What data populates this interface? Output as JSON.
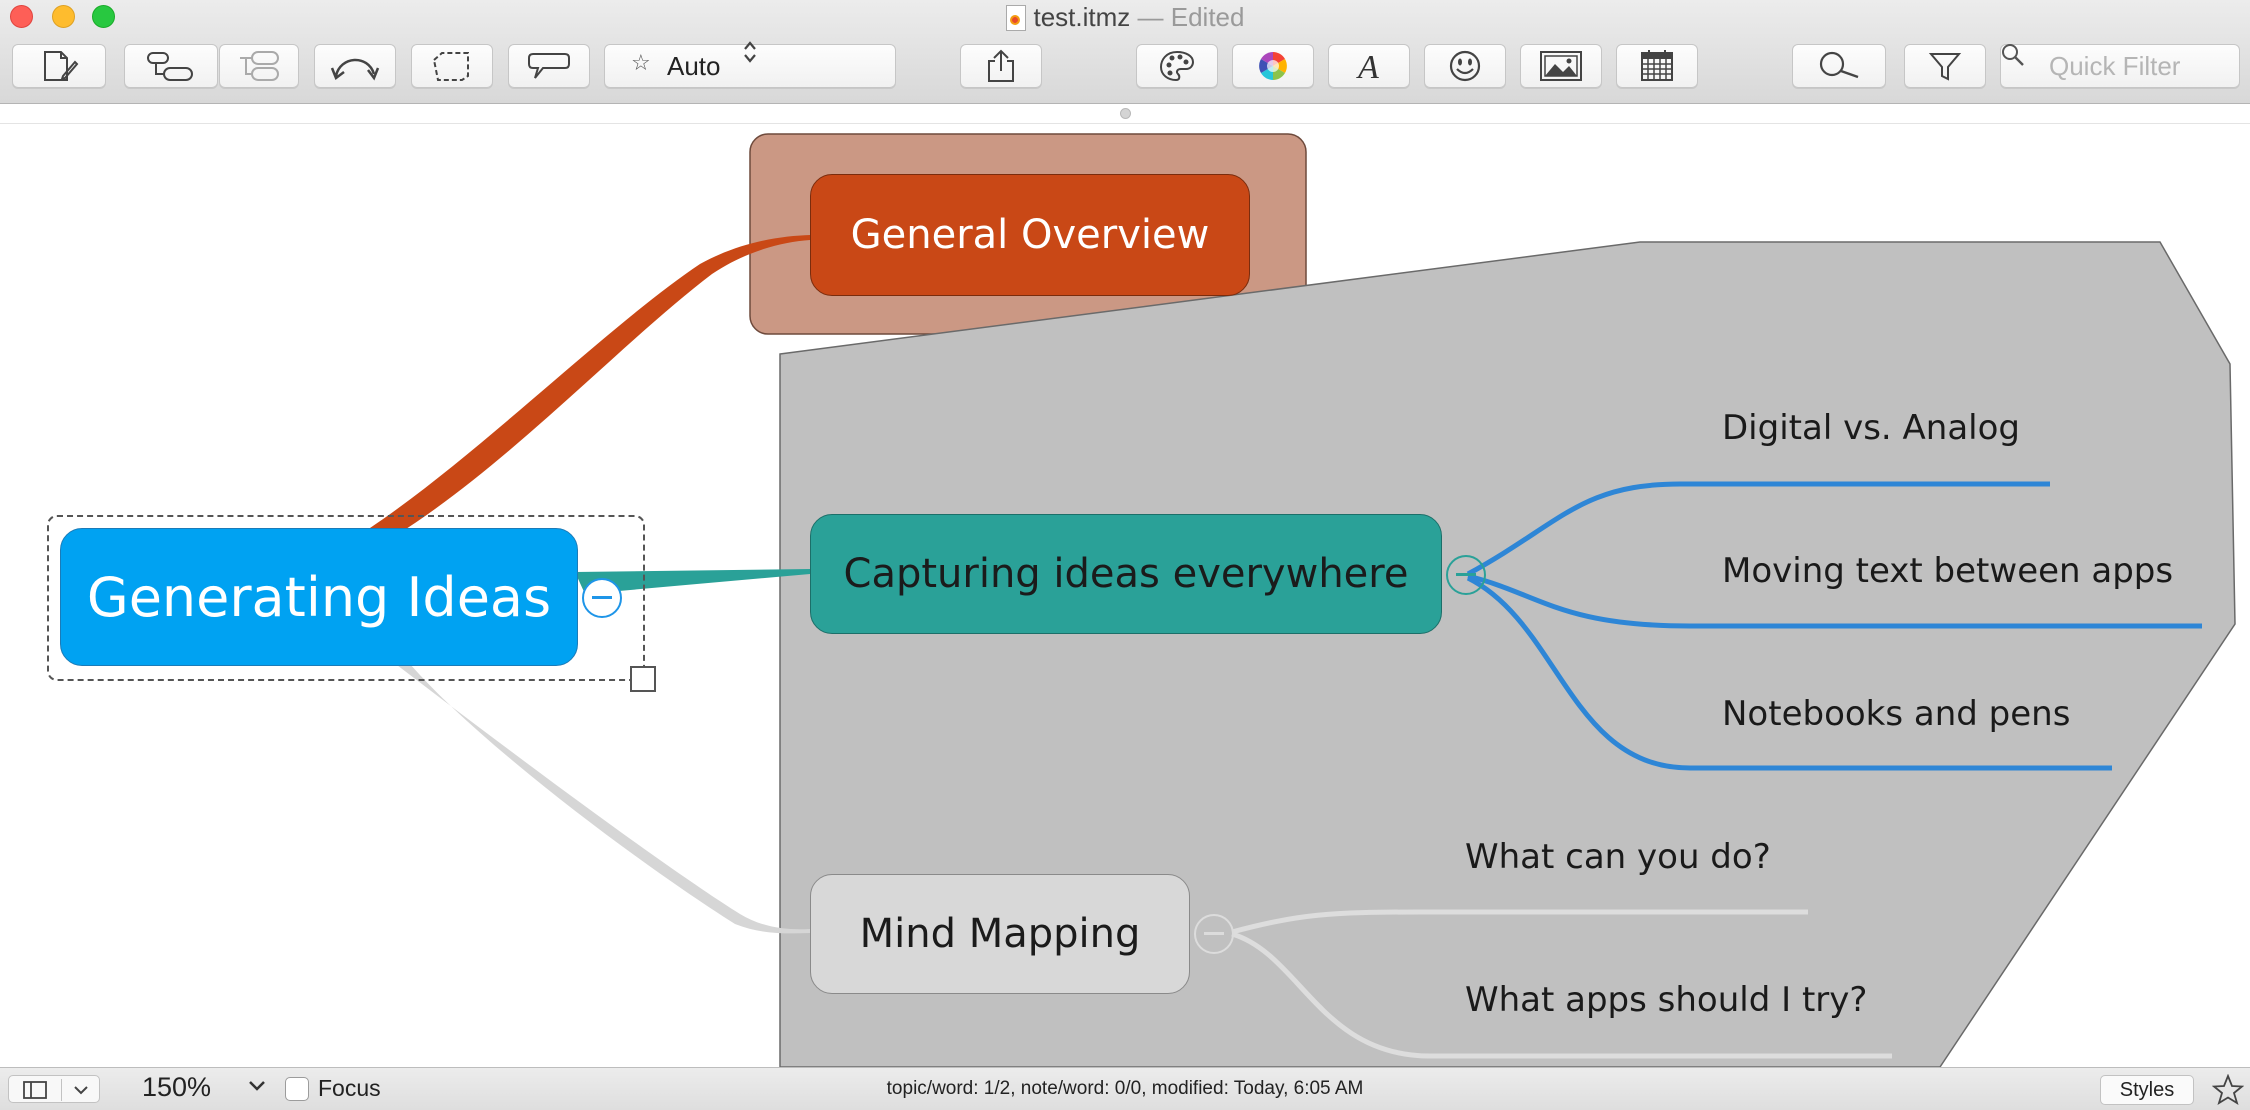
{
  "window": {
    "title": "test.itmz",
    "title_suffix": "— Edited"
  },
  "toolbar": {
    "style_select": {
      "value": "Auto"
    },
    "quick_filter": {
      "placeholder": "Quick Filter"
    },
    "icons": [
      "new-note-icon",
      "add-topic-icon",
      "add-subtopic-icon",
      "relationship-icon",
      "boundary-icon",
      "callout-icon",
      "share-icon",
      "styles-palette-icon",
      "color-wheel-icon",
      "font-icon",
      "emoji-icon",
      "image-icon",
      "calendar-icon",
      "search-icon",
      "filter-icon"
    ]
  },
  "mindmap": {
    "central": {
      "label": "Generating Ideas",
      "color": "#00a2f2",
      "text_color": "#ffffff"
    },
    "boundary_color": "#c0c0c0",
    "topics": [
      {
        "label": "General Overview",
        "color": "#c94816",
        "boundary": "#cb9884",
        "text_color": "#ffffff",
        "connector": "#c94816"
      },
      {
        "label": "Capturing ideas everywhere",
        "color": "#2aa198",
        "text_color": "#1b1b1b",
        "connector": "#2aa198",
        "subtopics": [
          "Digital vs. Analog",
          "Moving text between apps",
          "Notebooks and pens"
        ],
        "branch_color": "#2e86d6"
      },
      {
        "label": "Mind Mapping",
        "color": "#d8d8d8",
        "text_color": "#1b1b1b",
        "connector": "#d6d6d6",
        "subtopics": [
          "What can you do?",
          "What apps should I try?"
        ],
        "branch_color": "#dddddd"
      }
    ]
  },
  "statusbar": {
    "zoom": "150%",
    "focus_label": "Focus",
    "focus_checked": false,
    "status": "topic/word: 1/2, note/word: 0/0, modified: Today, 6:05 AM",
    "styles_label": "Styles"
  }
}
